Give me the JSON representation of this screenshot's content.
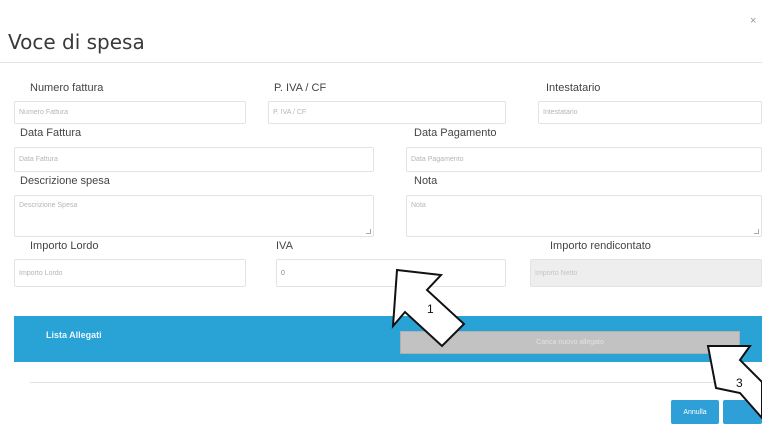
{
  "dialog": {
    "title": "Voce di spesa",
    "close_label": "×"
  },
  "fields": {
    "numero_fattura": {
      "label": "Numero fattura",
      "placeholder": "Numero Fattura"
    },
    "piva_cf": {
      "label": "P. IVA / CF",
      "placeholder": "P. IVA / CF"
    },
    "intestatario": {
      "label": "Intestatario",
      "placeholder": "Intestatario"
    },
    "data_fattura": {
      "label": "Data Fattura",
      "placeholder": "Data Fattura"
    },
    "data_pagamento": {
      "label": "Data Pagamento",
      "placeholder": "Data Pagamento"
    },
    "descrizione_spesa": {
      "label": "Descrizione spesa",
      "placeholder": "Descrizione Spesa"
    },
    "nota": {
      "label": "Nota",
      "placeholder": "Nota"
    },
    "importo_lordo": {
      "label": "Importo Lordo",
      "placeholder": "Importo Lordo"
    },
    "iva": {
      "label": "IVA",
      "value": "0"
    },
    "importo_rendicontato": {
      "label": "Importo rendicontato",
      "placeholder": "Importo Netto"
    }
  },
  "attachments": {
    "label": "Lista Allegati",
    "upload_label": "Carica nuovo allegato"
  },
  "footer": {
    "cancel_label": "Annulla"
  },
  "annotations": {
    "callout_1": "1",
    "callout_3": "3"
  }
}
